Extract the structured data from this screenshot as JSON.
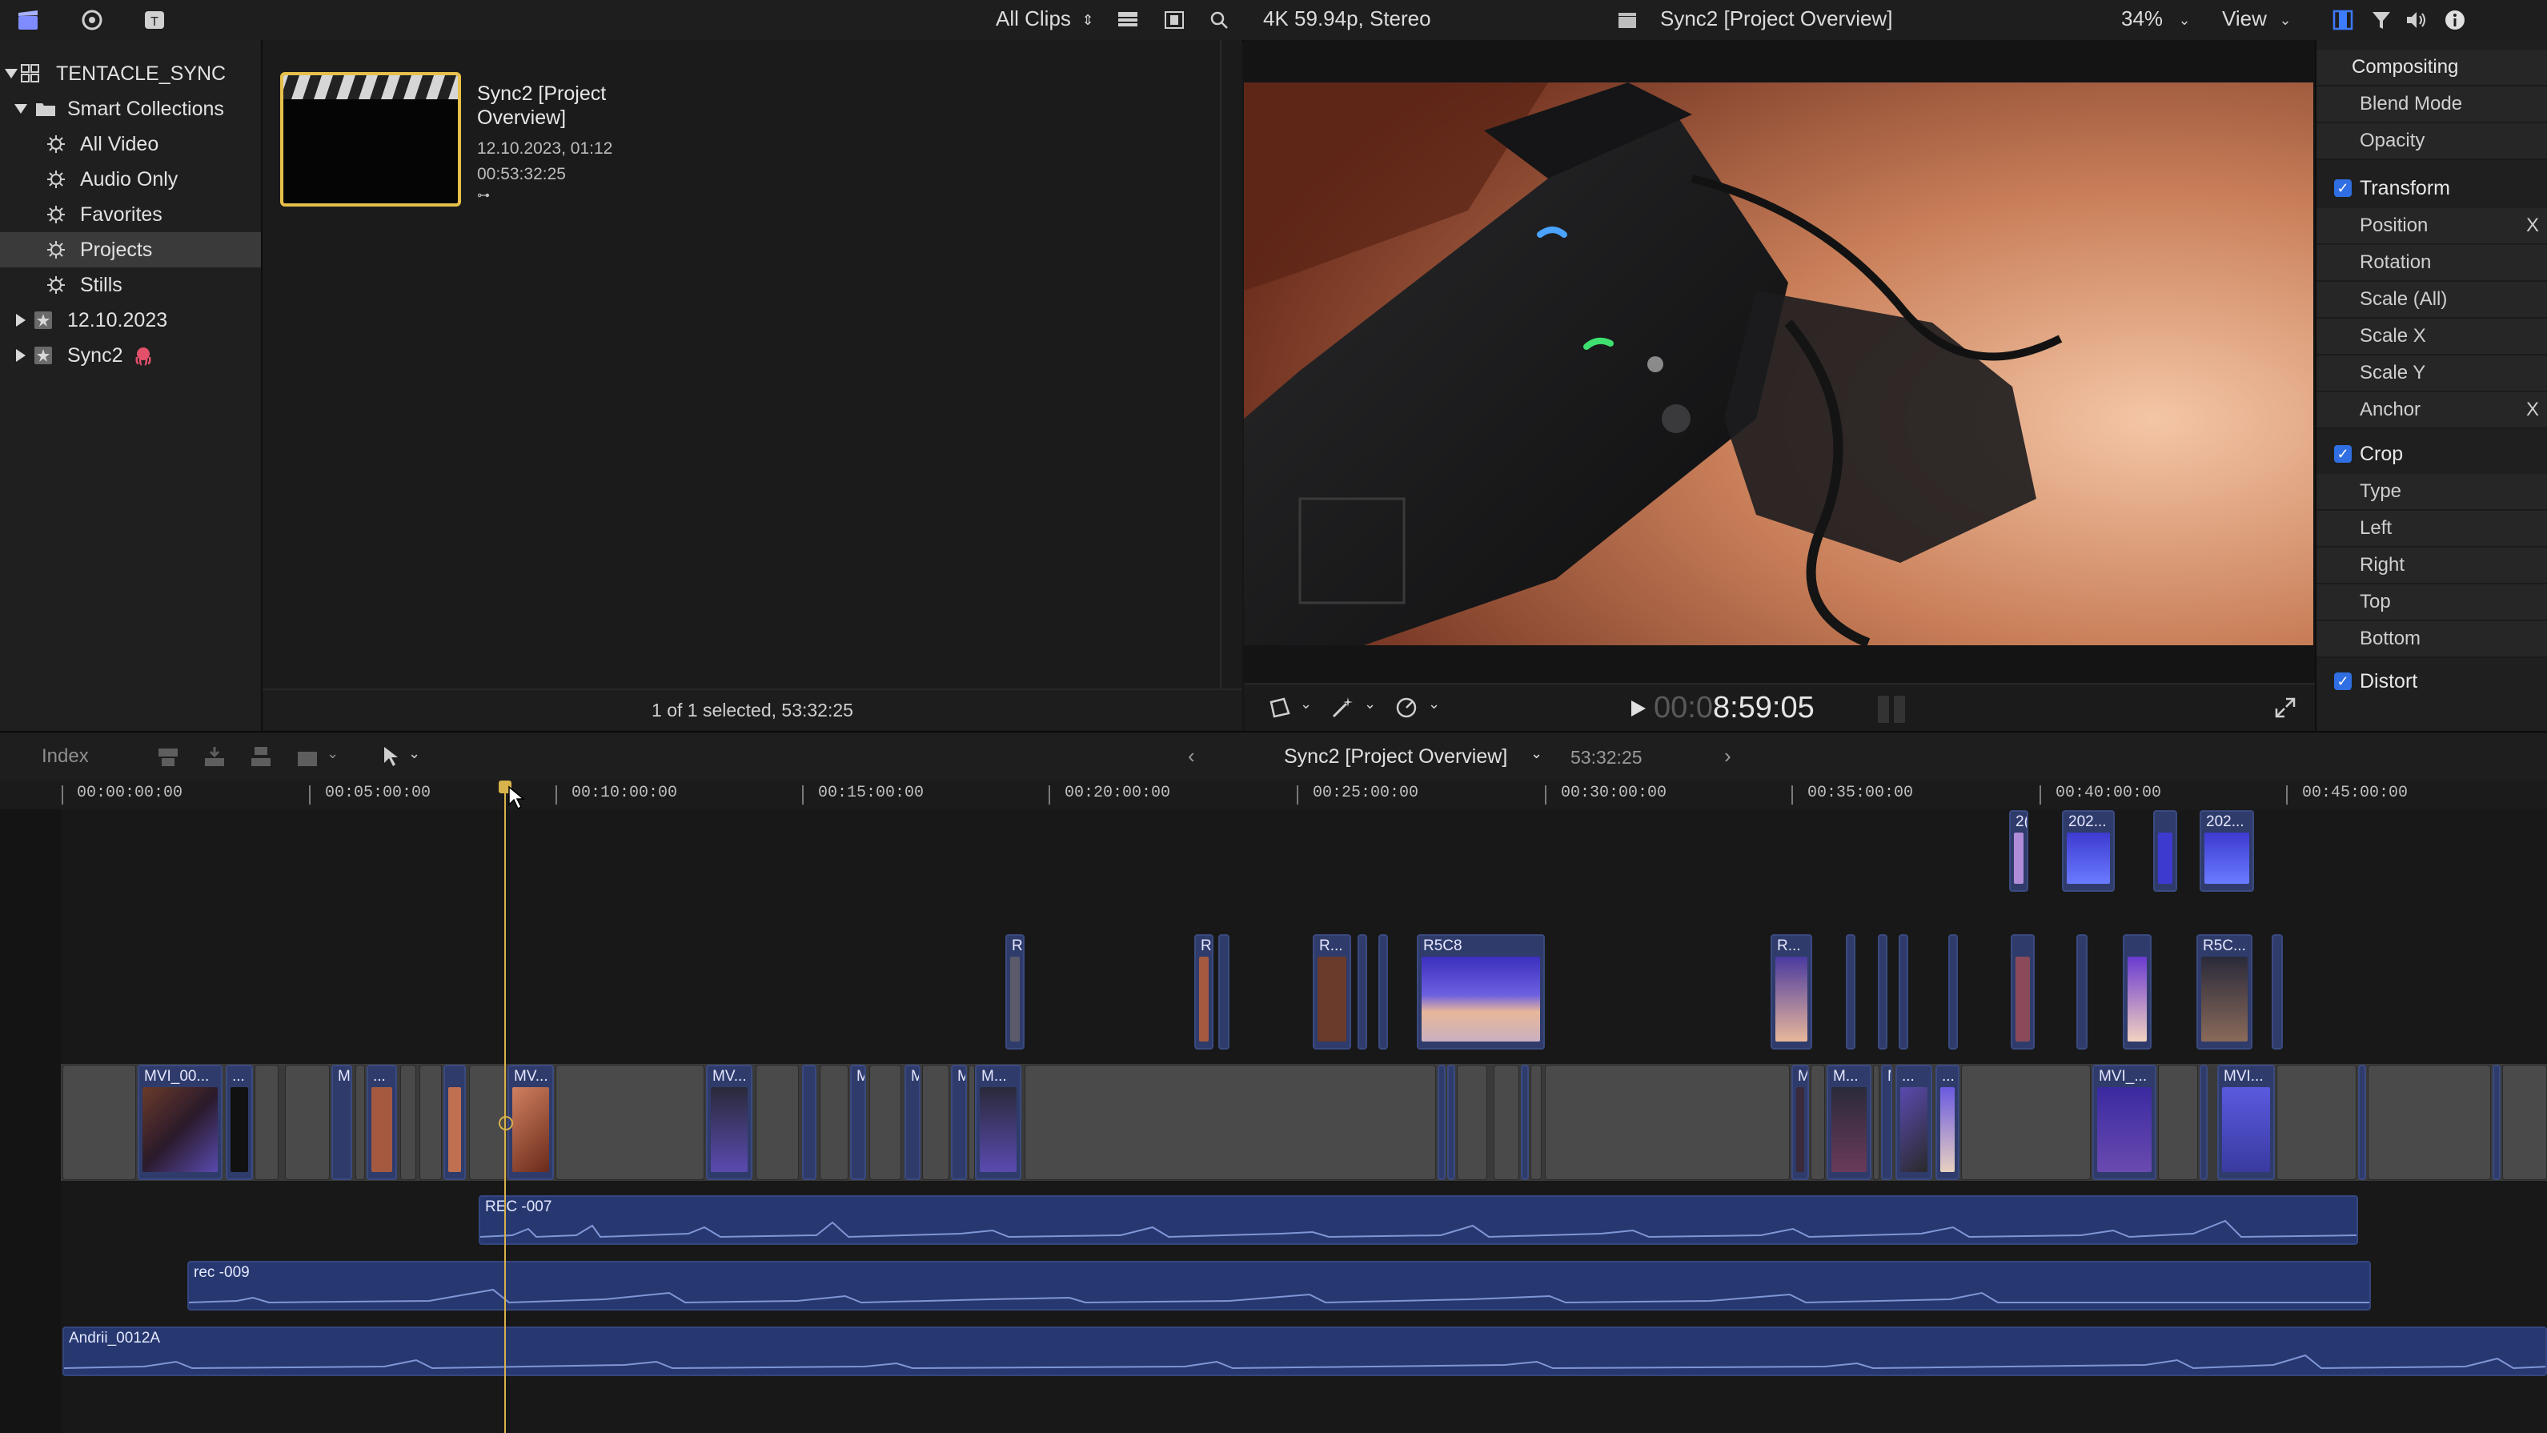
{
  "topbar": {
    "filter_label": "All Clips",
    "format_label": "4K 59.94p, Stereo",
    "viewer_title": "Sync2 [Project Overview]",
    "zoom": "34%",
    "view_label": "View"
  },
  "sidebar": {
    "library": "TENTACLE_SYNC",
    "smart_collections": "Smart Collections",
    "items": [
      {
        "label": "All Video"
      },
      {
        "label": "Audio Only"
      },
      {
        "label": "Favorites"
      },
      {
        "label": "Projects"
      },
      {
        "label": "Stills"
      }
    ],
    "events": [
      {
        "label": "12.10.2023"
      },
      {
        "label": "Sync2"
      }
    ]
  },
  "browser": {
    "clip": {
      "title_line1": "Sync2 [Project",
      "title_line2": "Overview]",
      "date": "12.10.2023, 01:12",
      "duration": "00:53:32:25"
    },
    "status": "1 of 1 selected, 53:32:25"
  },
  "viewer": {
    "timecode_dim": "00:0",
    "timecode": "8:59:05"
  },
  "inspector": {
    "compositing": "Compositing",
    "blend_mode": "Blend Mode",
    "opacity": "Opacity",
    "transform": "Transform",
    "position": "Position",
    "position_axis": "X",
    "rotation": "Rotation",
    "scale_all": "Scale (All)",
    "scale_x": "Scale X",
    "scale_y": "Scale Y",
    "anchor": "Anchor",
    "anchor_axis": "X",
    "crop": "Crop",
    "type": "Type",
    "left": "Left",
    "right": "Right",
    "top": "Top",
    "bottom": "Bottom",
    "distort": "Distort"
  },
  "timeline_toolbar": {
    "index": "Index",
    "project_name": "Sync2 [Project Overview]",
    "project_duration": "53:32:25"
  },
  "ruler": {
    "labels": [
      "00:00:00:00",
      "00:05:00:00",
      "00:10:00:00",
      "00:15:00:00",
      "00:20:00:00",
      "00:25:00:00",
      "00:30:00:00",
      "00:35:00:00",
      "00:40:00:00",
      "00:45:00:00"
    ]
  },
  "clips": {
    "primary": [
      "MVI_00...",
      "...",
      "M",
      "...",
      "MV...",
      "MV...",
      "M",
      "M",
      "M",
      "M...",
      "M",
      "M...",
      "M",
      "...",
      "...",
      "MVI_...",
      "MVI..."
    ],
    "connected_top": [
      "2(",
      "202...",
      "202..."
    ],
    "connected_mid": [
      "R",
      "R",
      "R...",
      "R5C8",
      "R...",
      "R5C..."
    ]
  },
  "audio": {
    "clip1": "REC  -007",
    "clip2": "rec  -009",
    "clip3": "Andrii_0012A"
  },
  "colors": {
    "accent": "#2f6fe3",
    "playhead": "#d8b24a",
    "clip_blue": "#2f3c6b",
    "audio_blue": "#273870"
  }
}
